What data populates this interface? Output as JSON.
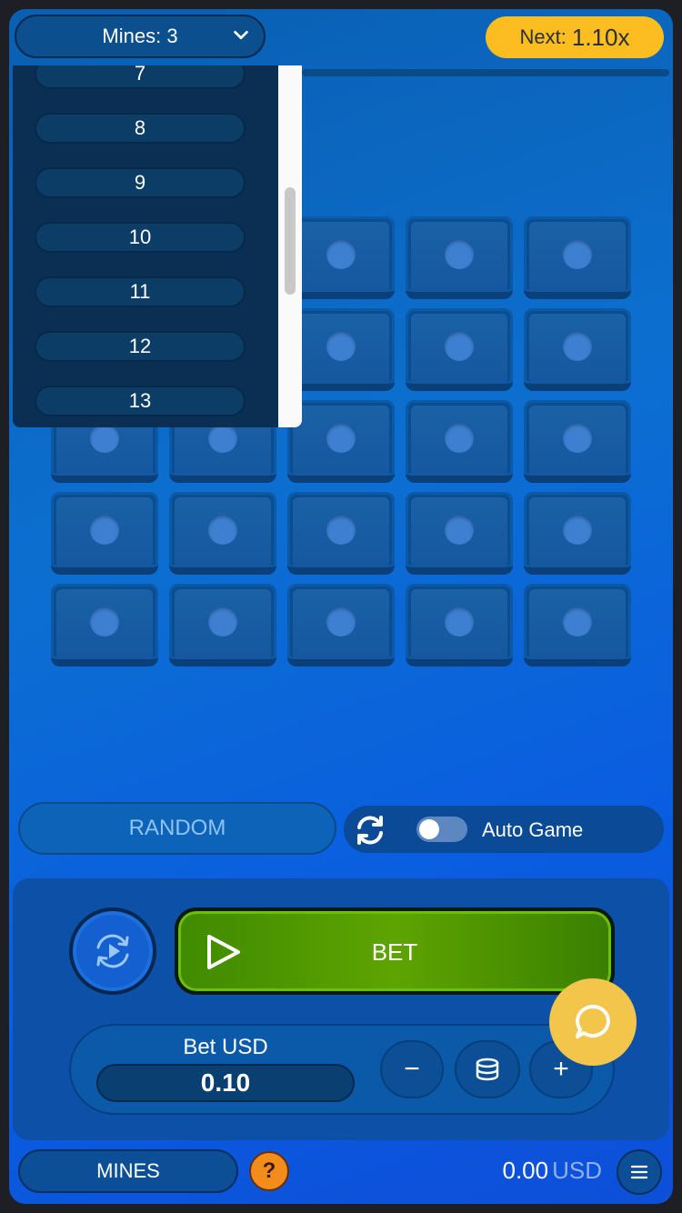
{
  "header": {
    "mines_label": "Mines: 3",
    "next_label": "Next:",
    "next_value": "1.10x",
    "progress": 0
  },
  "grid": {
    "rows": 5,
    "cols": 5
  },
  "mines_dropdown": {
    "options": [
      "7",
      "8",
      "9",
      "10",
      "11",
      "12",
      "13"
    ]
  },
  "controls": {
    "random_label": "RANDOM",
    "auto_game_label": "Auto Game",
    "auto_game_enabled": false
  },
  "bet_panel": {
    "bet_label": "BET",
    "amount_label": "Bet USD",
    "amount_value": "0.10",
    "minus_label": "−",
    "plus_label": "+"
  },
  "footer": {
    "mines_tab_label": "MINES",
    "help_label": "?",
    "balance_value": "0.00",
    "balance_currency": "USD"
  },
  "colors": {
    "next_pill": "#fbbd20",
    "bet_button": "#5ea400",
    "chat_button": "#f3c54b",
    "help_button": "#f28c1a"
  }
}
